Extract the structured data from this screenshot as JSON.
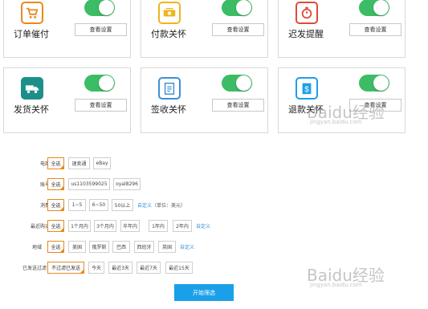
{
  "cards": [
    {
      "title": "订单催付",
      "button": "查看设置",
      "icon": "shopping-cart-icon",
      "color": "#e8891f",
      "toggle_on": true
    },
    {
      "title": "付款关怀",
      "button": "查看设置",
      "icon": "money-icon",
      "color": "#f0b41c",
      "toggle_on": true
    },
    {
      "title": "迟发提醒",
      "button": "查看设置",
      "icon": "stopwatch-icon",
      "color": "#e0493b",
      "toggle_on": true
    },
    {
      "title": "发货关怀",
      "button": "查看设置",
      "icon": "truck-icon",
      "color": "#1c8f8a",
      "toggle_on": true
    },
    {
      "title": "签收关怀",
      "button": "查看设置",
      "icon": "checklist-icon",
      "color": "#3c8fd4",
      "toggle_on": true
    },
    {
      "title": "退款关怀",
      "button": "查看设置",
      "icon": "refund-dollar-icon",
      "color": "#1aa0e8",
      "toggle_on": true
    }
  ],
  "filters": {
    "platform": {
      "label": "电商平台",
      "options": [
        "全选",
        "速卖通",
        "eBay"
      ]
    },
    "account": {
      "label": "账号选择",
      "options": [
        "全选",
        "us1103599025",
        "oyal8296"
      ]
    },
    "amount": {
      "label": "消费金额",
      "options": [
        "全选",
        "1~5",
        "6~50",
        "50以上"
      ],
      "custom": "自定义",
      "unit": "（单位：美元）"
    },
    "recent": {
      "label": "最近购买时间",
      "options": [
        "全选",
        "1个月内",
        "3个月内",
        "半年内",
        "1年内",
        "2年内"
      ],
      "custom": "自定义"
    },
    "region": {
      "label": "地域",
      "options": [
        "全选",
        "美国",
        "俄罗斯",
        "巴西",
        "西班牙",
        "英国"
      ],
      "custom": "自定义"
    },
    "sent": {
      "label": "已发送过滤",
      "options": [
        "不过滤已发送",
        "今天",
        "最近3天",
        "最近7天",
        "最近15天"
      ]
    }
  },
  "start_button": "开始筛选",
  "watermark": {
    "brand": "Baidu经验",
    "url": "jingyan.baidu.com"
  },
  "colors": {
    "accent_orange": "#e8891f",
    "toggle_green": "#3cbc65",
    "link_blue": "#3c8fd4",
    "primary_blue": "#1aa0e8"
  }
}
